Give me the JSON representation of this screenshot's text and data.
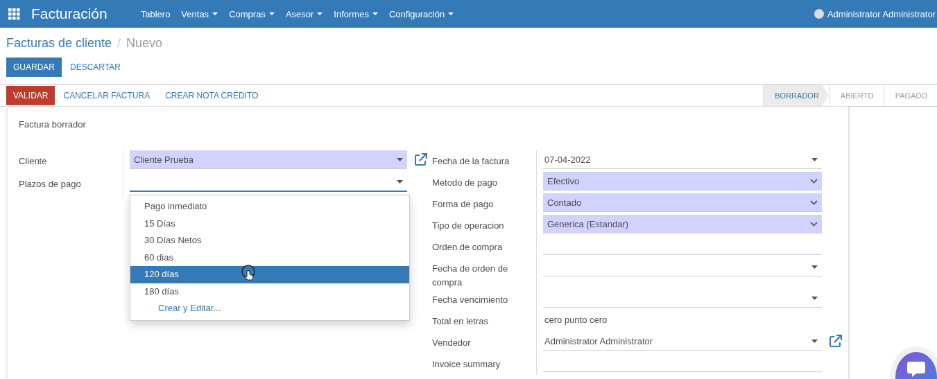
{
  "navbar": {
    "app_title": "Facturación",
    "menus": [
      {
        "label": "Tablero",
        "dropdown": false
      },
      {
        "label": "Ventas",
        "dropdown": true
      },
      {
        "label": "Compras",
        "dropdown": true
      },
      {
        "label": "Asesor",
        "dropdown": true
      },
      {
        "label": "Informes",
        "dropdown": true
      },
      {
        "label": "Configuración",
        "dropdown": true
      }
    ],
    "user": "Administrator Administrator"
  },
  "breadcrumb": {
    "parent": "Facturas de cliente",
    "separator": "/",
    "current": "Nuevo"
  },
  "form_buttons": [
    {
      "label": "GUARDAR",
      "kind": "primary"
    },
    {
      "label": "DESCARTAR",
      "kind": "link"
    }
  ],
  "actions": [
    {
      "label": "VALIDAR",
      "kind": "danger"
    },
    {
      "label": "CANCELAR FACTURA",
      "kind": "link"
    },
    {
      "label": "CREAR NOTA CRÉDITO",
      "kind": "link"
    }
  ],
  "stages": [
    {
      "label": "BORRADOR",
      "selected": true
    },
    {
      "label": "ABIERTO",
      "selected": false
    },
    {
      "label": "PAGADO",
      "selected": false
    }
  ],
  "sheet": {
    "title": "Factura borrador",
    "left_fields": [
      {
        "label": "Cliente",
        "value": "Cliente  Prueba",
        "kind": "many2one",
        "required": true,
        "focused": false,
        "external_link": true
      },
      {
        "label": "Plazos de pago",
        "kind": "many2one",
        "required": false,
        "focused": true,
        "external_link": false
      }
    ],
    "dropdown": {
      "items": [
        {
          "label": "Pago inmediato",
          "selected": false
        },
        {
          "label": "15 Días",
          "selected": false
        },
        {
          "label": "30 Días Netos",
          "selected": false
        },
        {
          "label": "60 dias",
          "selected": false
        },
        {
          "label": "120 días",
          "selected": true
        },
        {
          "label": "180 días",
          "selected": false
        }
      ],
      "create_label": "Crear y Editar..."
    },
    "right_fields": [
      {
        "label": "Fecha de la factura",
        "value": "07-04-2022",
        "kind": "date",
        "required": false,
        "external_link": false
      },
      {
        "label": "Metodo de pago",
        "value": "Efectivo",
        "kind": "select",
        "required": true,
        "external_link": false
      },
      {
        "label": "Forma de pago",
        "value": "Contado",
        "kind": "select",
        "required": true,
        "external_link": false
      },
      {
        "label": "Tipo de operacion",
        "value": "Generica (Estandar)",
        "kind": "select",
        "required": true,
        "external_link": false
      },
      {
        "label": "Orden de compra",
        "kind": "text",
        "required": false,
        "external_link": false
      },
      {
        "label": "Fecha de orden de compra",
        "kind": "date",
        "required": false,
        "external_link": false
      },
      {
        "label": "Fecha vencimiento",
        "kind": "date",
        "required": false,
        "external_link": false
      },
      {
        "label": "Total en letras",
        "value": "cero punto cero",
        "kind": "readonly",
        "required": false,
        "external_link": false
      },
      {
        "label": "Vendedor",
        "value": "Administrator  Administrator",
        "kind": "many2one",
        "required": false,
        "external_link": true
      },
      {
        "label": "Invoice summary",
        "kind": "text",
        "required": false,
        "external_link": false
      }
    ]
  }
}
